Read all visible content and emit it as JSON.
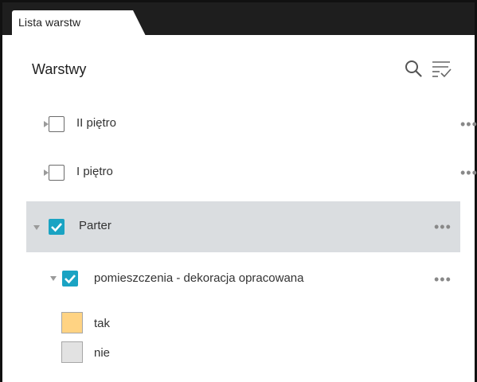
{
  "tab": {
    "label": "Lista warstw"
  },
  "panel": {
    "title": "Warstwy"
  },
  "layers": [
    {
      "name": "II piętro",
      "checked": false,
      "expanded": false
    },
    {
      "name": "I piętro",
      "checked": false,
      "expanded": false
    },
    {
      "name": "Parter",
      "checked": true,
      "expanded": true,
      "selected": true
    },
    {
      "name": "pomieszczenia - dekoracja opracowana",
      "checked": true,
      "expanded": true
    }
  ],
  "more_label": "•••",
  "legend": [
    {
      "label": "tak",
      "color": "#ffd383"
    },
    {
      "label": "nie",
      "color": "#e2e2e2"
    }
  ],
  "colors": {
    "accent": "#1aa3c3",
    "selected_row": "#dadde0",
    "tab_bar": "#1e1e1e"
  },
  "icons": {
    "search": "search-icon",
    "filter": "filter-list-icon",
    "more": "more-horizontal-icon"
  }
}
